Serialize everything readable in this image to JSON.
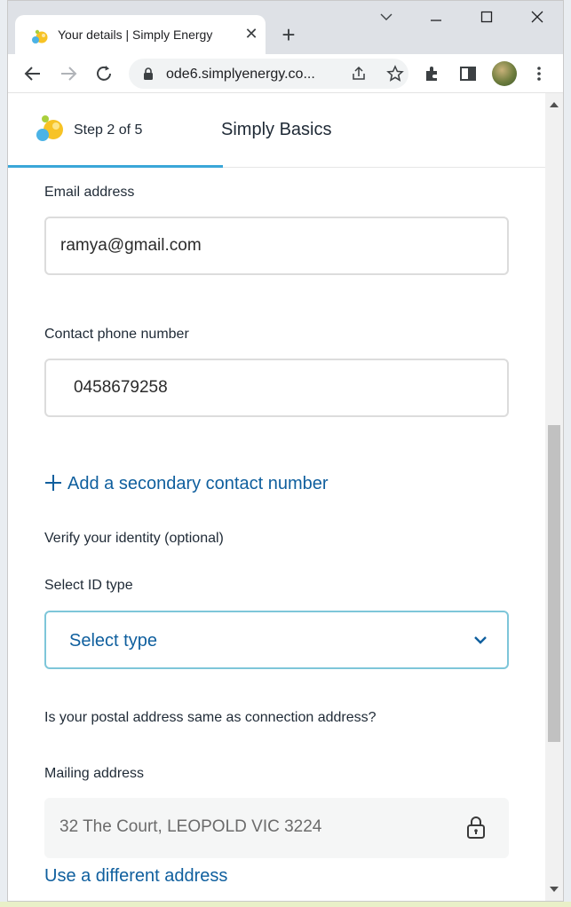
{
  "browser": {
    "tab_title": "Your details | Simply Energy",
    "tab_close": "✕",
    "new_tab": "+",
    "url": "ode6.simplyenergy.co..."
  },
  "stepper": {
    "step_label": "Step 2 of 5",
    "title": "Simply Basics"
  },
  "form": {
    "email_label": "Email address",
    "email_value": "ramya@gmail.com",
    "phone_label": "Contact phone number",
    "phone_value": "0458679258",
    "add_secondary": "Add a secondary contact number",
    "verify_heading": "Verify your identity (optional)",
    "id_type_label": "Select ID type",
    "id_type_value": "Select type",
    "postal_question": "Is your postal address same as connection address?",
    "mailing_label": "Mailing address",
    "mailing_value": "32 The Court, LEOPOLD  VIC  3224",
    "different_address": "Use a different address"
  },
  "colors": {
    "link": "#0f5f9e",
    "progress": "#3aa6d8",
    "select_border": "#7ec6d9"
  },
  "icons": [
    "favicon-bubbles-icon",
    "close-icon",
    "plus-icon",
    "chevron-down-icon",
    "minimize-icon",
    "maximize-icon",
    "window-close-icon",
    "back-arrow-icon",
    "forward-arrow-icon",
    "reload-icon",
    "lock-icon",
    "share-icon",
    "star-icon",
    "extensions-icon",
    "sidepanel-icon",
    "avatar",
    "more-vertical-icon",
    "add-plus-icon",
    "padlock-icon"
  ]
}
